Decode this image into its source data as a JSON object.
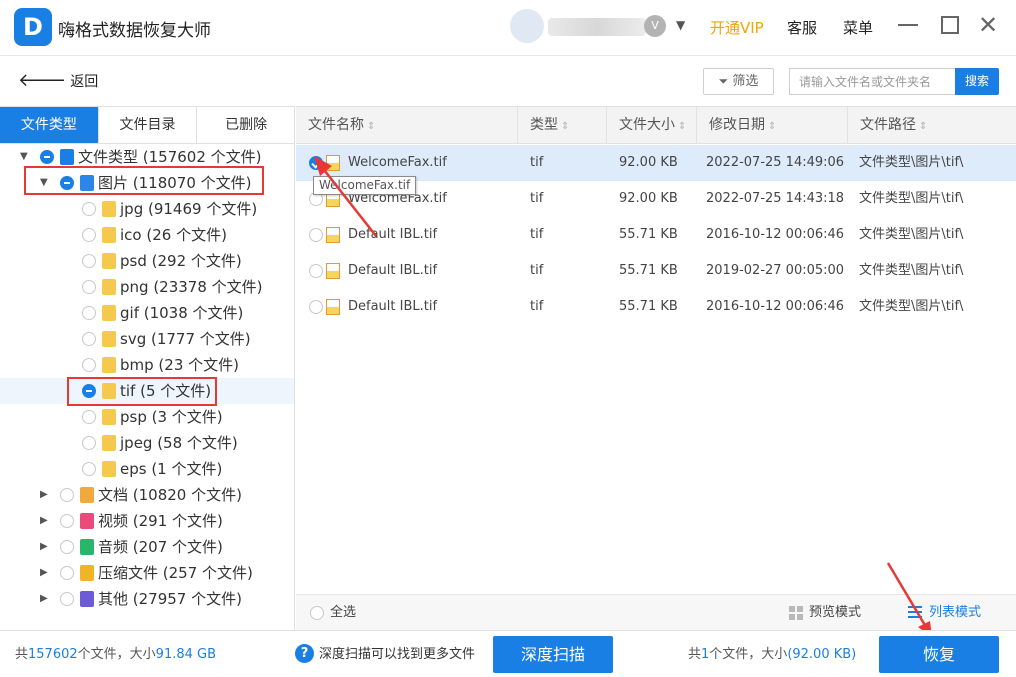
{
  "app": {
    "logo_letter": "D",
    "title": "嗨格式数据恢复大师",
    "user_dropdown": "▼",
    "vip_label": "开通VIP",
    "service_label": "客服",
    "menu_label": "菜单",
    "badge": "V"
  },
  "toolbar": {
    "back_label": "返回",
    "filter_label": "筛选",
    "search_placeholder": "请输入文件名或文件夹名",
    "search_button": "搜索"
  },
  "tabs": [
    "文件类型",
    "文件目录",
    "已删除"
  ],
  "tree": [
    {
      "label": "文件类型 (157602 个文件)",
      "state": "partial",
      "expanded": true,
      "icon": "computer-icon"
    },
    {
      "label": "图片 (118070 个文件)",
      "state": "partial",
      "expanded": true,
      "icon": "image-icon"
    },
    {
      "label": "jpg (91469 个文件)",
      "state": "none",
      "icon": "folder-icon"
    },
    {
      "label": "ico (26 个文件)",
      "state": "none",
      "icon": "folder-icon"
    },
    {
      "label": "psd (292 个文件)",
      "state": "none",
      "icon": "folder-icon"
    },
    {
      "label": "png (23378 个文件)",
      "state": "none",
      "icon": "folder-icon"
    },
    {
      "label": "gif (1038 个文件)",
      "state": "none",
      "icon": "folder-icon"
    },
    {
      "label": "svg (1777 个文件)",
      "state": "none",
      "icon": "folder-icon"
    },
    {
      "label": "bmp (23 个文件)",
      "state": "none",
      "icon": "folder-icon"
    },
    {
      "label": "tif (5 个文件)",
      "state": "partial",
      "icon": "folder-icon",
      "selected": true
    },
    {
      "label": "psp (3 个文件)",
      "state": "none",
      "icon": "folder-icon"
    },
    {
      "label": "jpeg (58 个文件)",
      "state": "none",
      "icon": "folder-icon"
    },
    {
      "label": "eps (1 个文件)",
      "state": "none",
      "icon": "folder-icon"
    },
    {
      "label": "文档 (10820 个文件)",
      "state": "none",
      "expanded": false,
      "icon": "document-icon"
    },
    {
      "label": "视频 (291 个文件)",
      "state": "none",
      "expanded": false,
      "icon": "video-icon"
    },
    {
      "label": "音频 (207 个文件)",
      "state": "none",
      "expanded": false,
      "icon": "audio-icon"
    },
    {
      "label": "压缩文件 (257 个文件)",
      "state": "none",
      "expanded": false,
      "icon": "archive-icon"
    },
    {
      "label": "其他 (27957 个文件)",
      "state": "none",
      "expanded": false,
      "icon": "other-icon"
    }
  ],
  "table": {
    "columns": [
      "文件名称",
      "类型",
      "文件大小",
      "修改日期",
      "文件路径"
    ],
    "rows": [
      {
        "name": "WelcomeFax.tif",
        "type": "tif",
        "size": "92.00 KB",
        "date": "2022-07-25 14:49:06",
        "path": "文件类型\\图片\\tif\\",
        "checked": true
      },
      {
        "name": "WelcomeFax.tif",
        "type": "tif",
        "size": "92.00 KB",
        "date": "2022-07-25 14:43:18",
        "path": "文件类型\\图片\\tif\\",
        "checked": false
      },
      {
        "name": "Default IBL.tif",
        "type": "tif",
        "size": "55.71 KB",
        "date": "2016-10-12 00:06:46",
        "path": "文件类型\\图片\\tif\\",
        "checked": false
      },
      {
        "name": "Default IBL.tif",
        "type": "tif",
        "size": "55.71 KB",
        "date": "2019-02-27 00:05:00",
        "path": "文件类型\\图片\\tif\\",
        "checked": false
      },
      {
        "name": "Default IBL.tif",
        "type": "tif",
        "size": "55.71 KB",
        "date": "2016-10-12 00:06:46",
        "path": "文件类型\\图片\\tif\\",
        "checked": false
      }
    ],
    "tooltip": "WelcomeFax.tif"
  },
  "footer": {
    "select_all": "全选",
    "preview_mode": "预览模式",
    "list_mode": "列表模式"
  },
  "status": {
    "total_prefix": "共",
    "total_count": "157602",
    "total_mid": "个文件，大小",
    "total_size": "91.84 GB",
    "deep_hint": "深度扫描可以找到更多文件",
    "deep_button": "深度扫描",
    "sel_prefix": "共",
    "sel_count": "1",
    "sel_mid": "个文件，大小",
    "sel_size": "(92.00 KB)",
    "recover_button": "恢复"
  },
  "colors": {
    "accent": "#1a7fe5",
    "vip": "#f0a500",
    "highlight": "#e53935"
  }
}
